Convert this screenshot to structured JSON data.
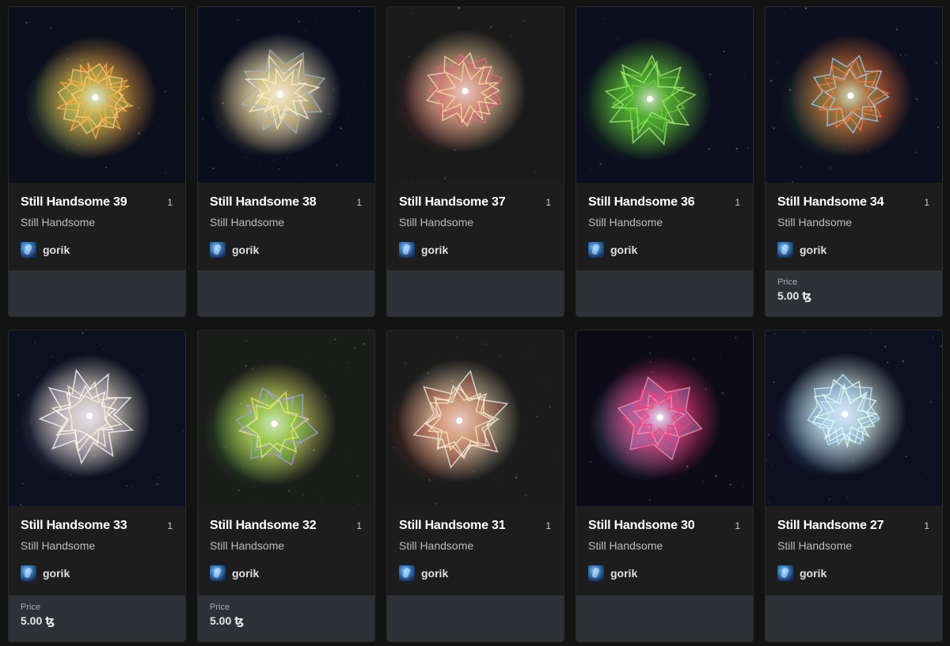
{
  "colors": {
    "page_bg": "#131313",
    "card_bg": "#1d1d1d",
    "footer_bg": "#2e3135"
  },
  "cards": [
    {
      "title": "Still Handsome 39",
      "edition": "1",
      "collection": "Still Handsome",
      "author": "gorik",
      "price_label": "",
      "price": "",
      "art": {
        "bg": "#0d0f1c",
        "glow": "#ffb347",
        "accent": "#7fd36b",
        "stroke": "#ffd27a"
      }
    },
    {
      "title": "Still Handsome 38",
      "edition": "1",
      "collection": "Still Handsome",
      "author": "gorik",
      "price_label": "",
      "price": "",
      "art": {
        "bg": "#0a0d1e",
        "glow": "#fff2c8",
        "accent": "#e8c86a",
        "stroke": "#9fb3c8"
      }
    },
    {
      "title": "Still Handsome 37",
      "edition": "1",
      "collection": "Still Handsome",
      "author": "gorik",
      "price_label": "",
      "price": "",
      "art": {
        "bg": "#1a1a1a",
        "glow": "#ffd9a6",
        "accent": "#c0394f",
        "stroke": "#e06a8a"
      }
    },
    {
      "title": "Still Handsome 36",
      "edition": "1",
      "collection": "Still Handsome",
      "author": "gorik",
      "price_label": "",
      "price": "",
      "art": {
        "bg": "#0b0f1e",
        "glow": "#6bd33a",
        "accent": "#3f9b2a",
        "stroke": "#a8f07a"
      }
    },
    {
      "title": "Still Handsome 34",
      "edition": "1",
      "collection": "Still Handsome",
      "author": "gorik",
      "price_label": "Price",
      "price": "5.00 ꜩ",
      "art": {
        "bg": "#0c0f1e",
        "glow": "#ff7a3a",
        "accent": "#2e8c4a",
        "stroke": "#9fd0ff"
      }
    },
    {
      "title": "Still Handsome 33",
      "edition": "1",
      "collection": "Still Handsome",
      "author": "gorik",
      "price_label": "Price",
      "price": "5.00 ꜩ",
      "art": {
        "bg": "#0c1020",
        "glow": "#fff4e0",
        "accent": "#b0a8c8",
        "stroke": "#ffffff"
      }
    },
    {
      "title": "Still Handsome 32",
      "edition": "1",
      "collection": "Still Handsome",
      "author": "gorik",
      "price_label": "Price",
      "price": "5.00 ꜩ",
      "art": {
        "bg": "#1b1d1a",
        "glow": "#e8f06a",
        "accent": "#3fb83a",
        "stroke": "#a89be8"
      }
    },
    {
      "title": "Still Handsome 31",
      "edition": "1",
      "collection": "Still Handsome",
      "author": "gorik",
      "price_label": "",
      "price": "",
      "art": {
        "bg": "#1c1c1c",
        "glow": "#ffe9c0",
        "accent": "#c0392b",
        "stroke": "#f2efe6"
      }
    },
    {
      "title": "Still Handsome 30",
      "edition": "1",
      "collection": "Still Handsome",
      "author": "gorik",
      "price_label": "",
      "price": "",
      "art": {
        "bg": "#0d0b18",
        "glow": "#ff3a7a",
        "accent": "#a0b8ff",
        "stroke": "#ff8fb3"
      }
    },
    {
      "title": "Still Handsome 27",
      "edition": "1",
      "collection": "Still Handsome",
      "author": "gorik",
      "price_label": "",
      "price": "",
      "art": {
        "bg": "#0c1020",
        "glow": "#e8fff4",
        "accent": "#7ab8ff",
        "stroke": "#c8f0ff"
      }
    }
  ]
}
